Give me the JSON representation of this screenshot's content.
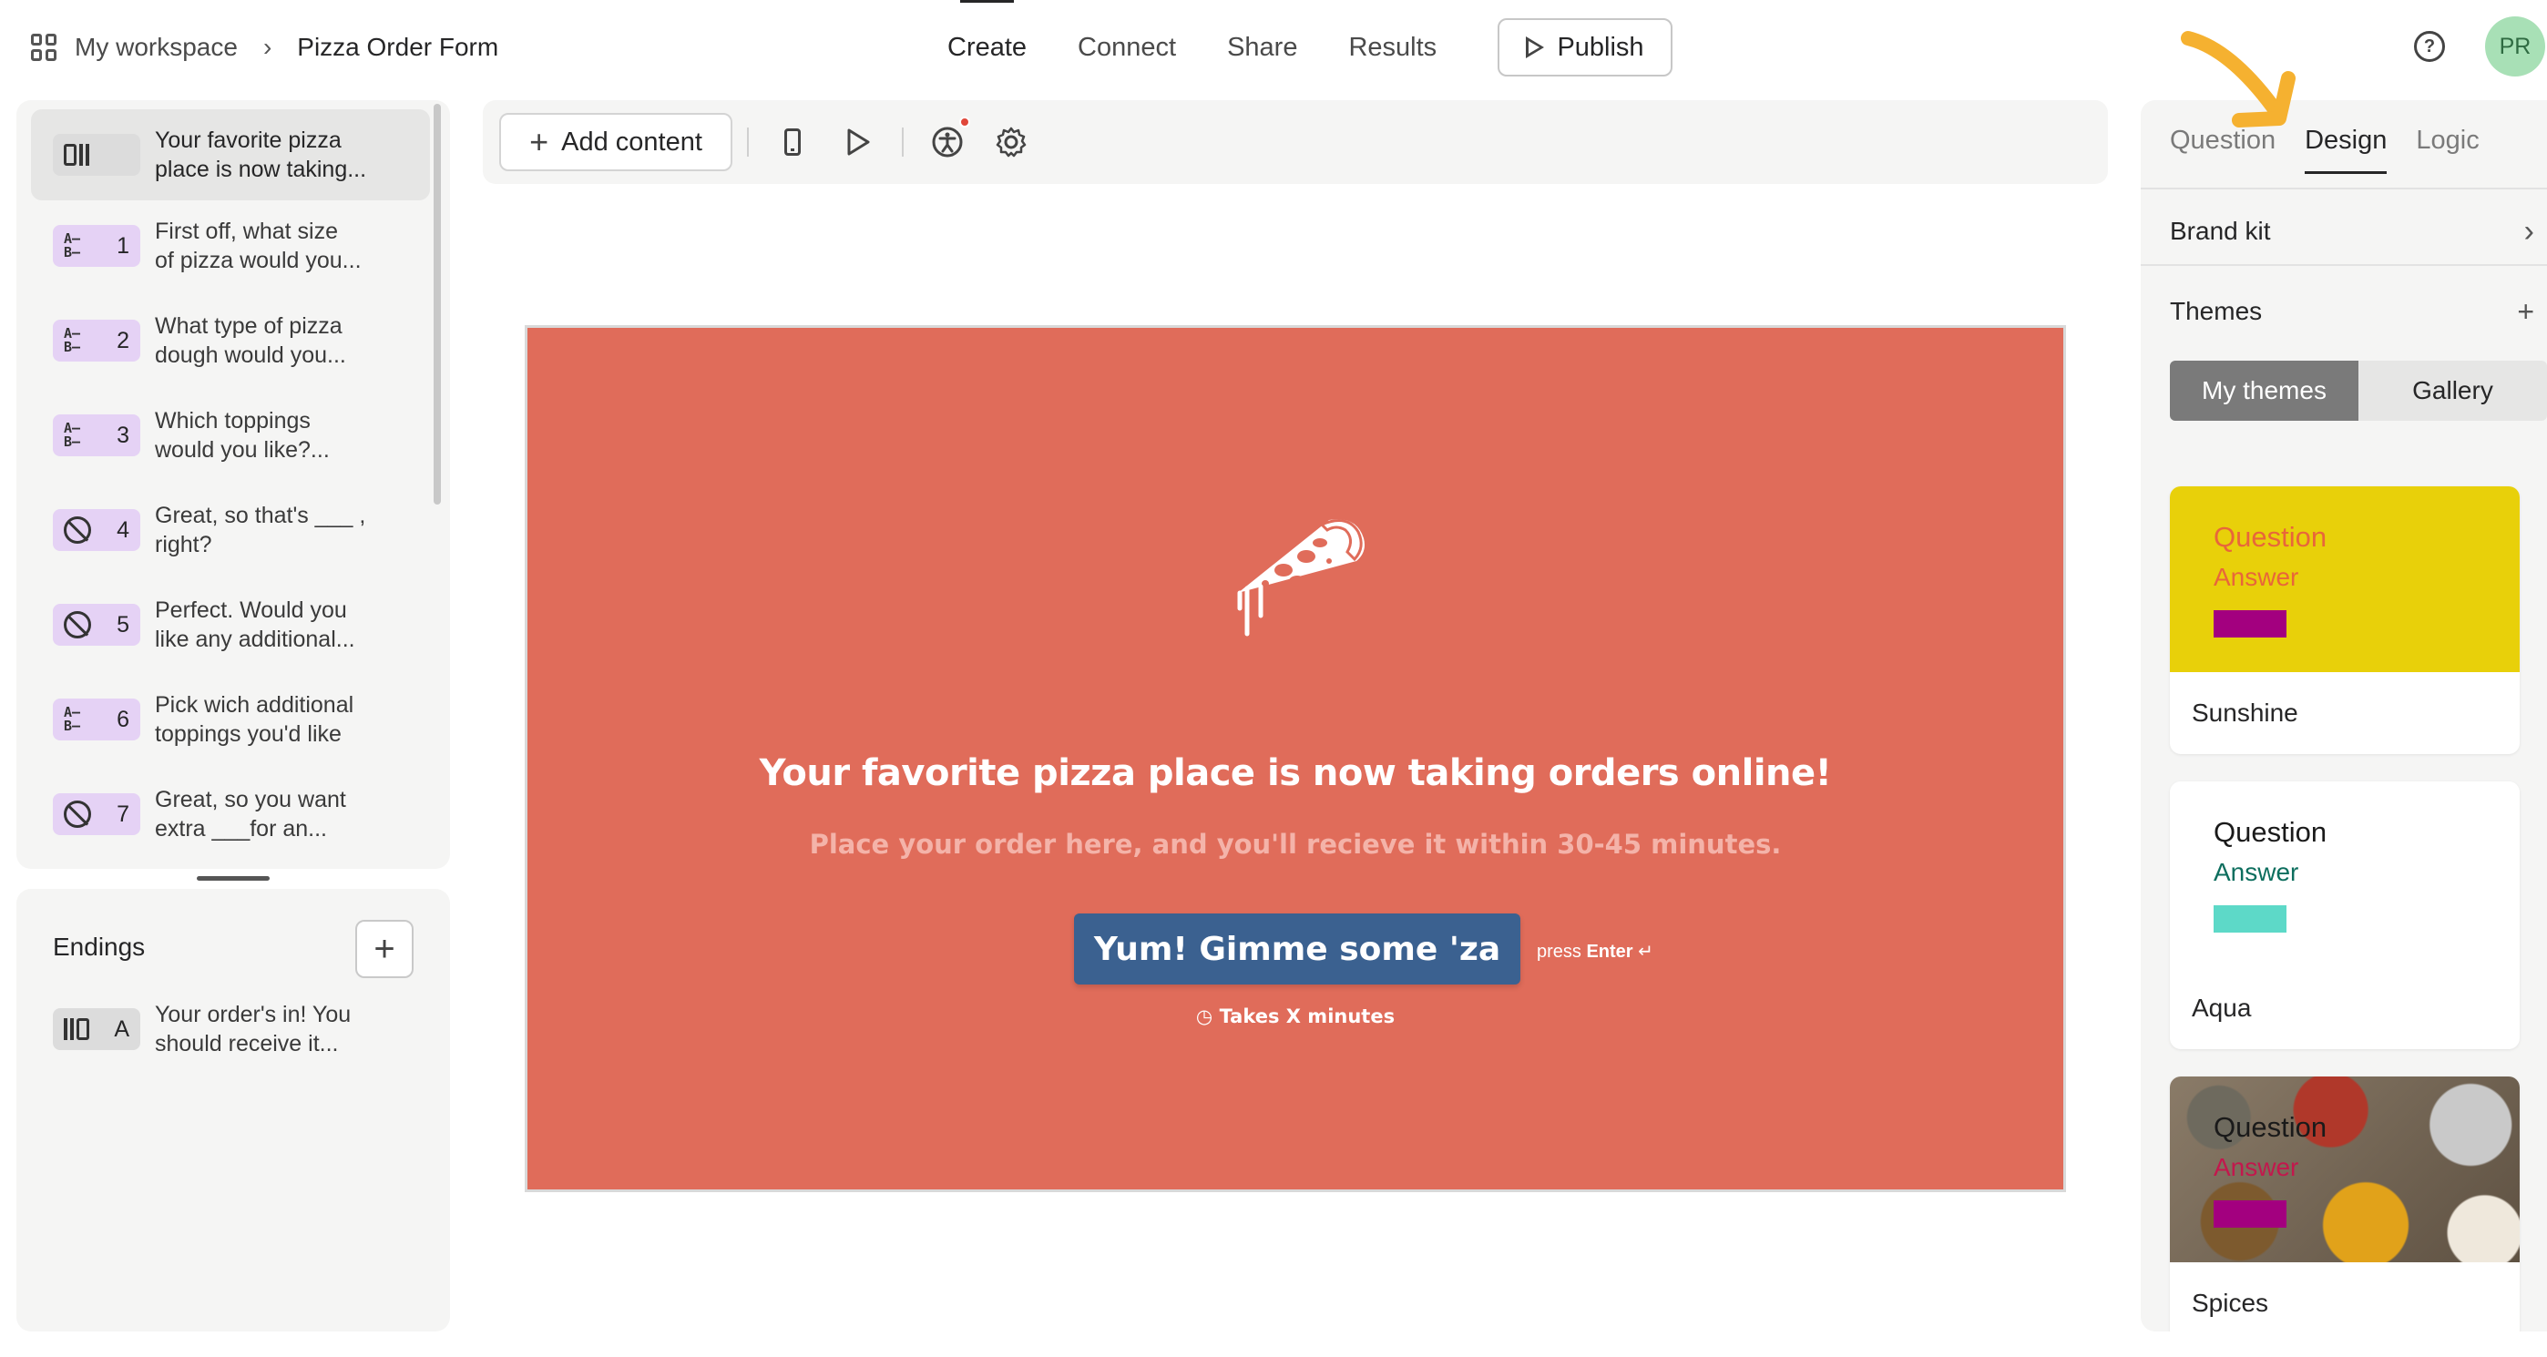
{
  "header": {
    "workspace": "My workspace",
    "form_name": "Pizza Order Form",
    "tabs": [
      {
        "label": "Create",
        "active": true
      },
      {
        "label": "Connect",
        "active": false
      },
      {
        "label": "Share",
        "active": false
      },
      {
        "label": "Results",
        "active": false
      }
    ],
    "publish_label": "Publish",
    "help_icon": "help-circle-icon",
    "avatar_initials": "PR"
  },
  "sidebar": {
    "questions": [
      {
        "icon": "welcome-screen-icon",
        "num": "",
        "text_line1": "Your favorite pizza",
        "text_line2": "place is now taking...",
        "active": true
      },
      {
        "icon": "multiple-choice-icon",
        "num": "1",
        "text_line1": "First off, what size",
        "text_line2": "of pizza would you..."
      },
      {
        "icon": "multiple-choice-icon",
        "num": "2",
        "text_line1": "What type of pizza",
        "text_line2": "dough would you..."
      },
      {
        "icon": "multiple-choice-icon",
        "num": "3",
        "text_line1": "Which toppings",
        "text_line2": "would you like?..."
      },
      {
        "icon": "yes-no-icon",
        "num": "4",
        "text_line1": "Great, so that's ___ ,",
        "text_line2": "right?"
      },
      {
        "icon": "yes-no-icon",
        "num": "5",
        "text_line1": "Perfect. Would you",
        "text_line2": "like any additional..."
      },
      {
        "icon": "multiple-choice-icon",
        "num": "6",
        "text_line1": "Pick wich additional",
        "text_line2": "toppings you'd like"
      },
      {
        "icon": "yes-no-icon",
        "num": "7",
        "text_line1": "Great, so you want",
        "text_line2": "extra ___for an..."
      }
    ],
    "endings_title": "Endings",
    "endings": [
      {
        "icon": "ending-screen-icon",
        "num": "A",
        "text_line1": "Your order's in! You",
        "text_line2": "should receive it..."
      }
    ]
  },
  "toolbar": {
    "add_content_label": "Add content"
  },
  "preview": {
    "bg_color": "#e06c5a",
    "title": "Your favorite pizza place is now taking orders online!",
    "subtitle": "Place your order here, and you'll recieve it within 30-45 minutes.",
    "button_label": "Yum! Gimme some 'za",
    "button_color": "#3b6190",
    "press_label": "press",
    "enter_label": "Enter",
    "enter_symbol": "↵",
    "time_label": "Takes X minutes"
  },
  "right_panel": {
    "tabs": [
      {
        "label": "Question",
        "active": false
      },
      {
        "label": "Design",
        "active": true
      },
      {
        "label": "Logic",
        "active": false
      }
    ],
    "brand_kit_label": "Brand kit",
    "themes_label": "Themes",
    "segments": [
      {
        "label": "My themes",
        "active": true
      },
      {
        "label": "Gallery",
        "active": false
      }
    ],
    "themes": [
      {
        "name": "Sunshine",
        "question": "Question",
        "answer": "Answer",
        "bg": "#e8d00a",
        "question_color": "#e8663a",
        "answer_color": "#e8663a",
        "button_color": "#a3007f"
      },
      {
        "name": "Aqua",
        "question": "Question",
        "answer": "Answer",
        "bg": "#ffffff",
        "question_color": "#1a1a1a",
        "answer_color": "#0d6e5e",
        "button_color": "#5dd9c8"
      },
      {
        "name": "Spices",
        "question": "Question",
        "answer": "Answer",
        "bg": "#7a6a58",
        "question_color": "#1a1a1a",
        "answer_color": "#c2184d",
        "button_color": "#a3007f"
      }
    ]
  }
}
